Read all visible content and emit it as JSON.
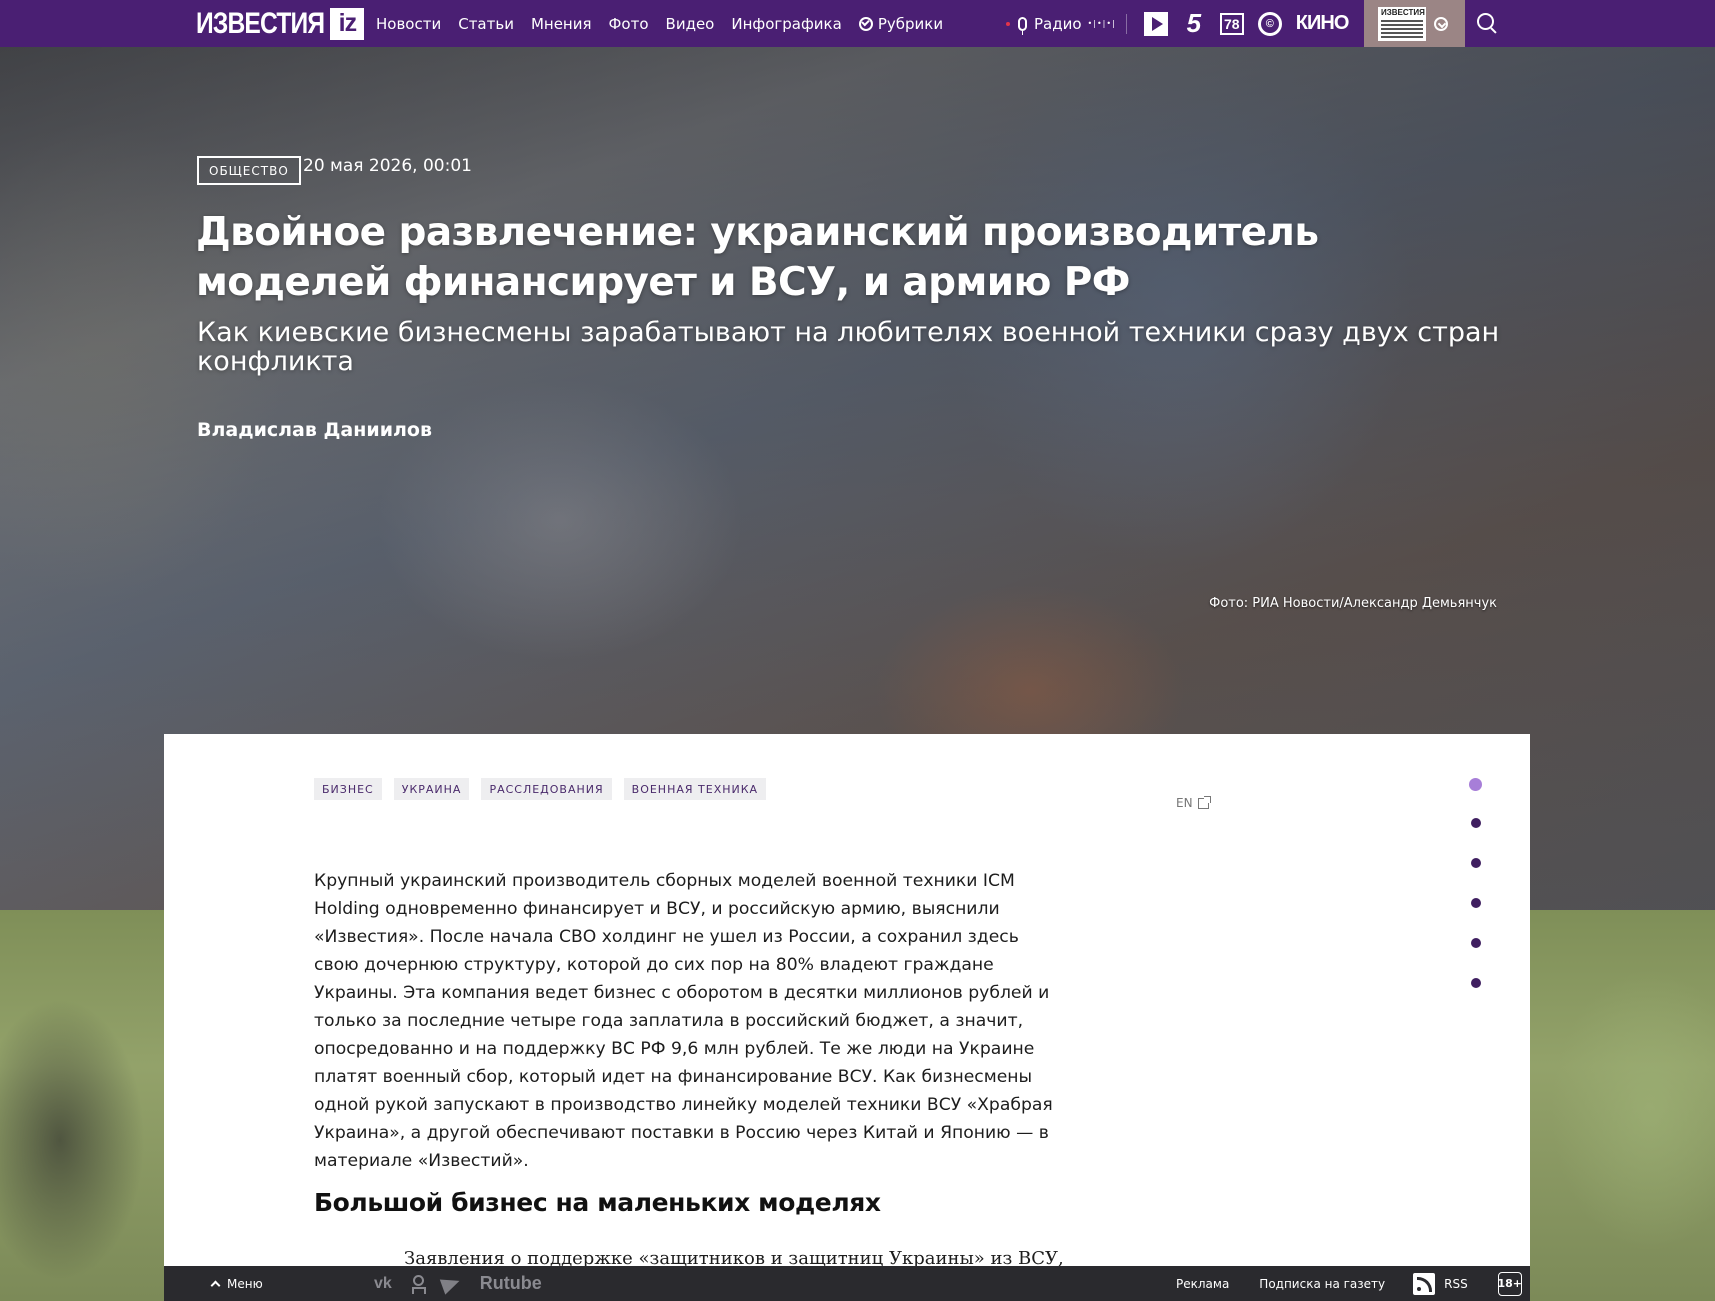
{
  "nav": {
    "logo_text": "ИЗВЕСТИЯ",
    "logo_badge": "iz",
    "links": [
      "Новости",
      "Статьи",
      "Мнения",
      "Фото",
      "Видео",
      "Инфографика"
    ],
    "rubrics_label": "Рубрики",
    "radio_label": "Радио",
    "radio_eq": "•|•|•|",
    "channels": {
      "five": "5",
      "seventyeight": "78",
      "ring": "©",
      "kino": "КИНО"
    },
    "newspaper_label": "ИЗВЕСТИЯ"
  },
  "hero": {
    "category": "ОБЩЕСТВО",
    "date": "20 мая 2026, 00:01",
    "title": "Двойное развлечение: украинский производитель моделей финансирует и ВСУ, и армию РФ",
    "subtitle": "Как киевские бизнесмены зарабатывают на любителях военной техники сразу двух стран конфликта",
    "author": "Владислав Даниилов",
    "photo_credit": "Фото: РИА Новости/Александр Демьянчук"
  },
  "article": {
    "tags": [
      "БИЗНЕС",
      "УКРАИНА",
      "РАССЛЕДОВАНИЯ",
      "ВОЕННАЯ ТЕХНИКА"
    ],
    "en_label": "EN",
    "lead": "Крупный украинский производитель сборных моделей военной техники ICM Holding одновременно финансирует и ВСУ, и российскую армию, выяснили «Известия». После начала СВО холдинг не ушел из России, а сохранил здесь свою дочернюю структуру, которой до сих пор на 80% владеют граждане Украины. Эта компания ведет бизнес с оборотом в десятки миллионов рублей и только за последние четыре года заплатила в российский бюджет, а значит, опосредованно и на поддержку ВС РФ 9,6 млн рублей. Те же люди на Украине платят военный сбор, который идет на финансирование ВСУ. Как бизнесмены одной рукой запускают в производство линейку моделей техники ВСУ «Храбрая Украина», а другой обеспечивают поставки в Россию через Китай и Японию — в материале «Известий».",
    "heading": "Большой бизнес на маленьких моделях",
    "paragraph2": "Заявления о поддержке «защитников и защитниц Украины» из ВСУ,"
  },
  "bottombar": {
    "menu_label": "Меню",
    "vk_label": "vk",
    "rutube_label": "Rutube",
    "ads_label": "Реклама",
    "subscribe_label": "Подписка на газету",
    "rss_label": "RSS",
    "age_label": "18+"
  },
  "colors": {
    "brand": "#4a1f73",
    "dot_active": "#a77ed8",
    "dot": "#3f1f60"
  }
}
